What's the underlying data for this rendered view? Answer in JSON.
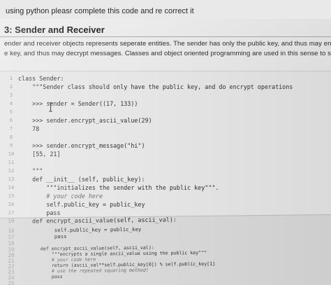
{
  "question": "using python pleasr complete this code and re correct it",
  "section": {
    "title": "3: Sender and Receiver",
    "desc_line1": "ender and receiver objects represents seperate entities. The sender has only the public key, and thus may en",
    "desc_line2": "e key, and thus may decrypt messages. Classes and object oriented programming are used in this sense to si"
  },
  "code_top": [
    {
      "n": "1",
      "text": "class Sender:"
    },
    {
      "n": "2",
      "text": "    \"\"\"Sender class should only have the public key, and do encrypt operations"
    },
    {
      "n": "3",
      "text": ""
    },
    {
      "n": "4",
      "text": "    >>> sender = Sender((17, 133))"
    },
    {
      "n": "5",
      "text": ""
    },
    {
      "n": "6",
      "text": "    >>> sender.encrypt_ascii_value(29)"
    },
    {
      "n": "7",
      "text": "    78"
    },
    {
      "n": "8",
      "text": ""
    },
    {
      "n": "9",
      "text": "    >>> sender.encrypt_message(\"hi\")"
    },
    {
      "n": "10",
      "text": "    [55, 21]"
    },
    {
      "n": "11",
      "text": ""
    },
    {
      "n": "12",
      "text": "    \"\"\""
    },
    {
      "n": "13",
      "text": "    def __init__ (self, public_key):"
    },
    {
      "n": "14",
      "text": "        \"\"\"initializes the sender with the public key\"\"\"."
    },
    {
      "n": "15",
      "text": "        # your code here"
    },
    {
      "n": "16",
      "text": "        self.public_key = public_key"
    },
    {
      "n": "17",
      "text": "        pass"
    },
    {
      "n": "18",
      "text": ""
    },
    {
      "n": "19",
      "text": "    def encrypt_ascii_value(self, ascii_val):"
    }
  ],
  "code_bottom": [
    {
      "n": "16",
      "text": "    self.public_key = public_key"
    },
    {
      "n": "17",
      "text": "    pass"
    },
    {
      "n": "18",
      "text": ""
    },
    {
      "n": "19",
      "text": "def encrypt_ascii_value(self, ascii_val):"
    },
    {
      "n": "20",
      "text": "    \"\"\"encrypts a single ascii_value using the public key\"\"\""
    },
    {
      "n": "21",
      "text": "    # your code here"
    },
    {
      "n": "22",
      "text": "    return (ascii_val**self.public_key[0]) % self.public_key[1]"
    },
    {
      "n": "23",
      "text": "    # use the repeated squaring method!"
    },
    {
      "n": "24",
      "text": "    pass"
    },
    {
      "n": "25",
      "text": ""
    }
  ]
}
